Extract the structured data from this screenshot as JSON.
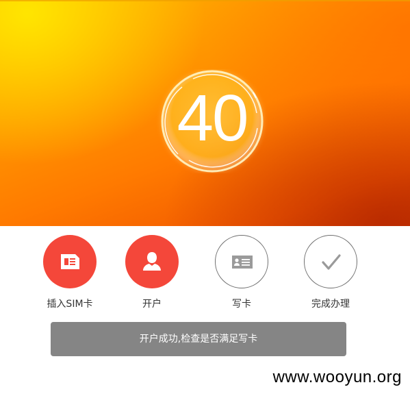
{
  "hero": {
    "counter_value": "40"
  },
  "steps": [
    {
      "label": "插入SIM卡",
      "icon": "sim-card-icon",
      "state": "done"
    },
    {
      "label": "开户",
      "icon": "user-icon",
      "state": "done"
    },
    {
      "label": "写卡",
      "icon": "id-card-icon",
      "state": "pending"
    },
    {
      "label": "完成办理",
      "icon": "checkmark-icon",
      "state": "pending"
    }
  ],
  "status": {
    "message": "开户成功,检查是否满足写卡"
  },
  "watermark": "www.wooyun.org",
  "colors": {
    "accent_red": "#f4473a",
    "status_gray": "#858585",
    "hero_orange": "#ff8a00"
  }
}
